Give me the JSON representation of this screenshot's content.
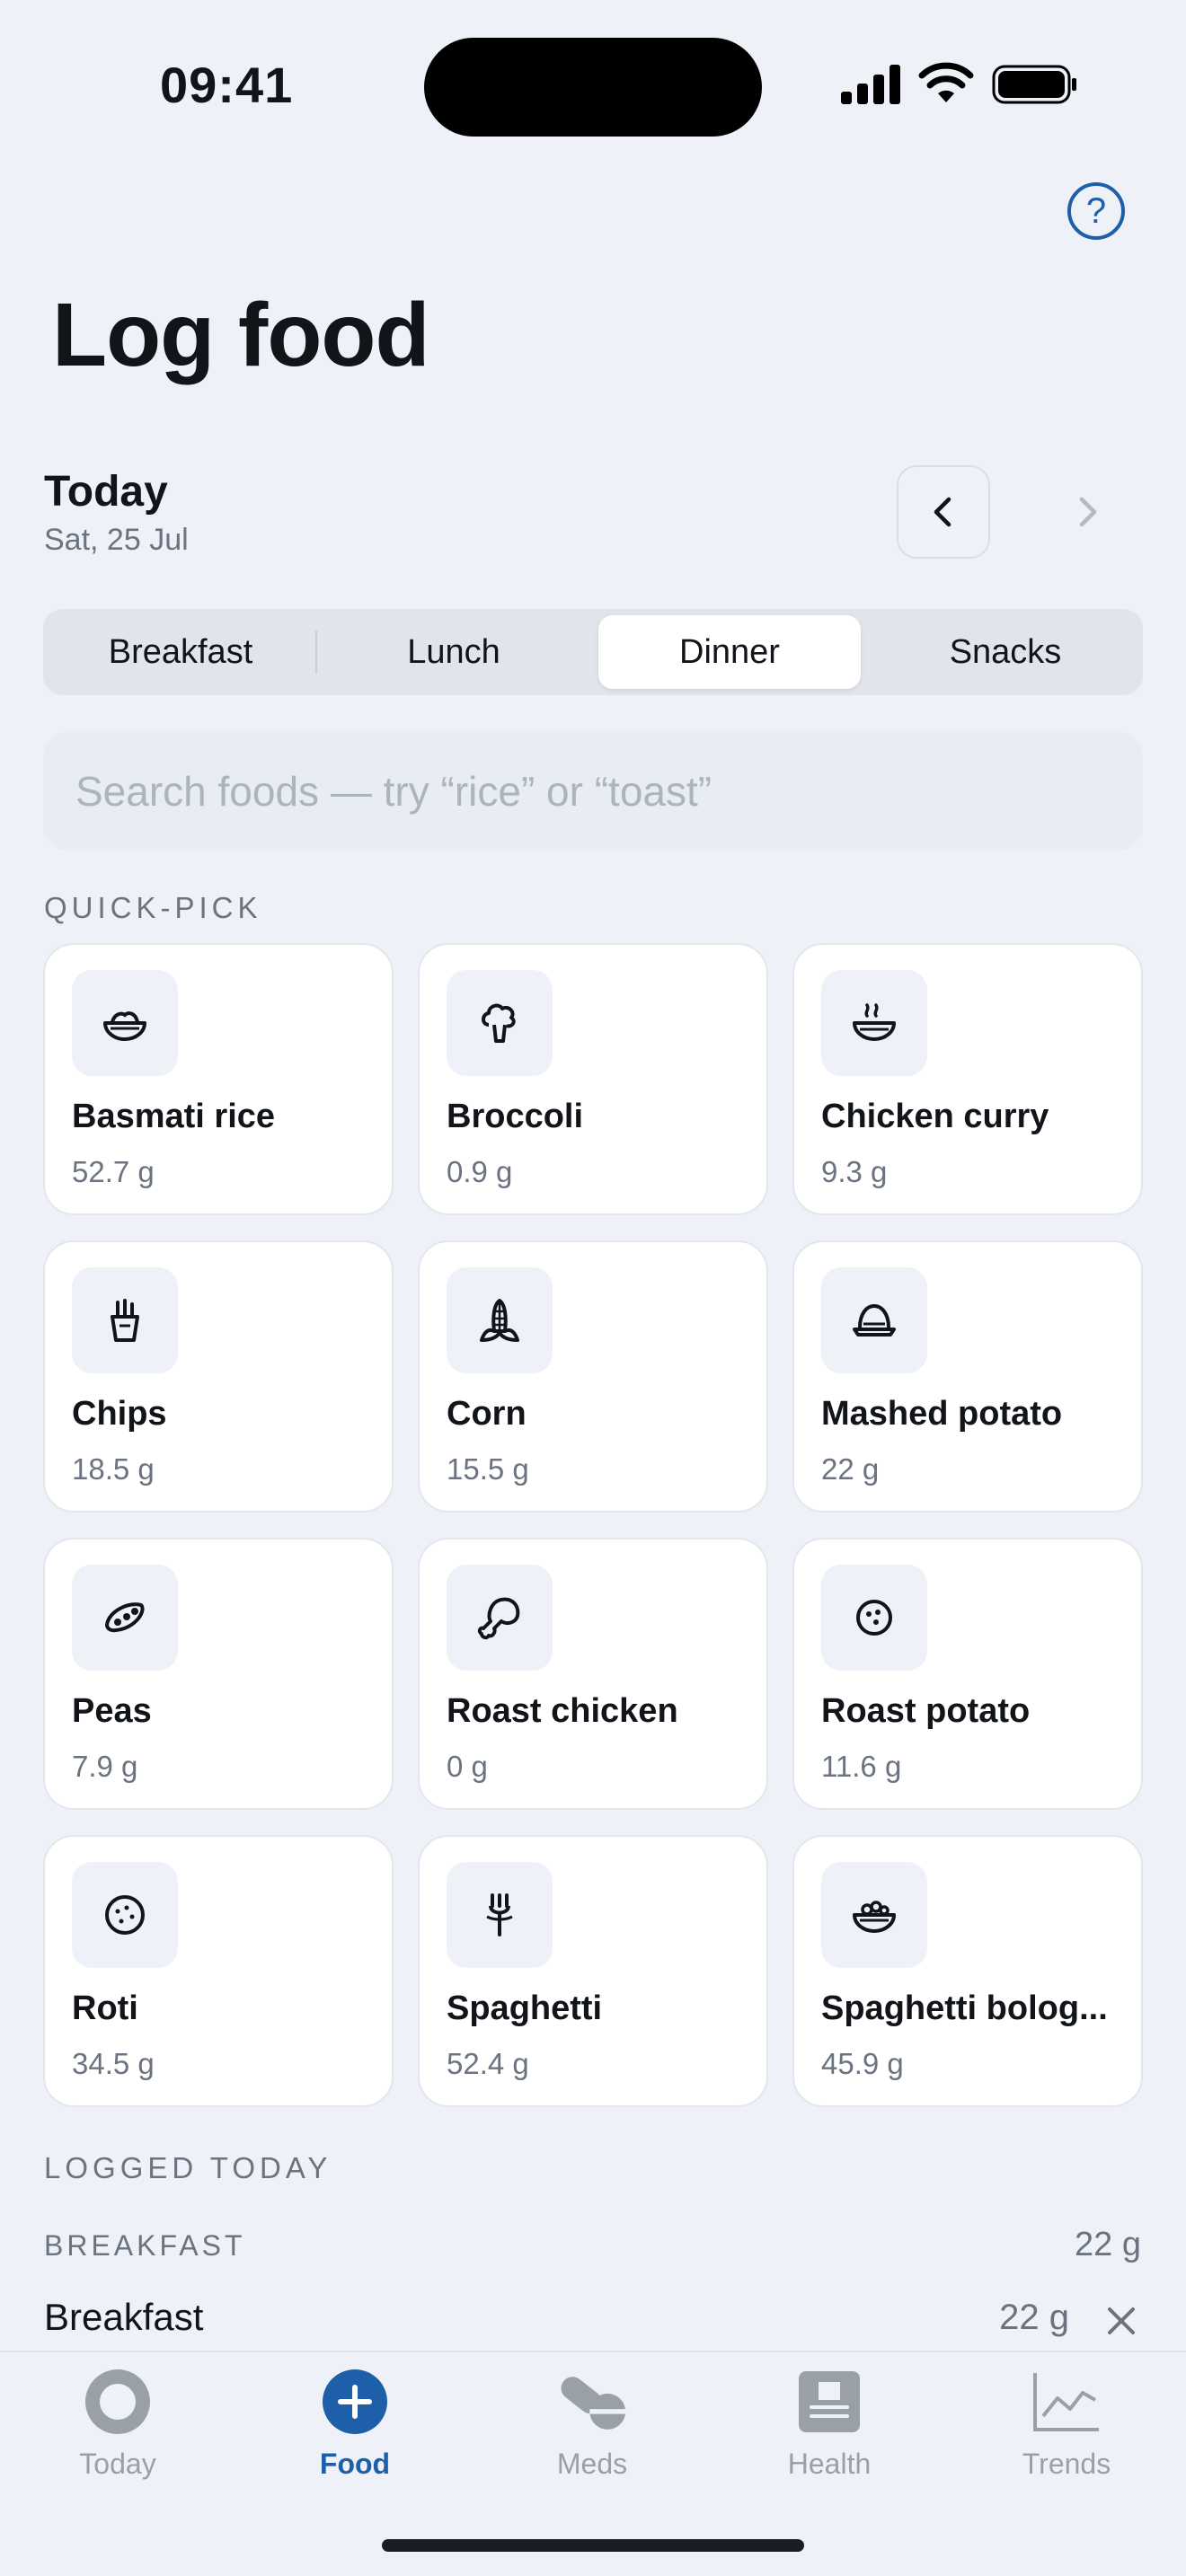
{
  "status_bar": {
    "time": "09:41"
  },
  "header": {
    "title": "Log food",
    "help_icon": "question-circle-icon",
    "help_label": "?"
  },
  "date": {
    "label": "Today",
    "sub": "Sat, 25 Jul"
  },
  "meal_tabs": {
    "items": [
      "Breakfast",
      "Lunch",
      "Dinner",
      "Snacks"
    ],
    "selected": "Dinner"
  },
  "search": {
    "placeholder": "Search foods — try “rice” or “toast”",
    "value": ""
  },
  "quick_pick": {
    "label": "QUICK-PICK",
    "items": [
      {
        "name": "Basmati rice",
        "amount": "52.7 g",
        "icon": "rice-bowl-icon"
      },
      {
        "name": "Broccoli",
        "amount": "0.9 g",
        "icon": "broccoli-icon"
      },
      {
        "name": "Chicken curry",
        "amount": "9.3 g",
        "icon": "curry-bowl-icon"
      },
      {
        "name": "Chips",
        "amount": "18.5 g",
        "icon": "fries-icon"
      },
      {
        "name": "Corn",
        "amount": "15.5 g",
        "icon": "corn-icon"
      },
      {
        "name": "Mashed potato",
        "amount": "22 g",
        "icon": "mash-icon"
      },
      {
        "name": "Peas",
        "amount": "7.9 g",
        "icon": "peas-icon"
      },
      {
        "name": "Roast chicken",
        "amount": "0 g",
        "icon": "drumstick-icon"
      },
      {
        "name": "Roast potato",
        "amount": "11.6 g",
        "icon": "potato-icon"
      },
      {
        "name": "Roti",
        "amount": "34.5 g",
        "icon": "flatbread-icon"
      },
      {
        "name": "Spaghetti",
        "amount": "52.4 g",
        "icon": "fork-icon"
      },
      {
        "name": "Spaghetti bolog...",
        "amount": "45.9 g",
        "icon": "pasta-bowl-icon"
      }
    ]
  },
  "logged_today": {
    "label": "LOGGED TODAY",
    "group_label": "BREAKFAST",
    "group_total": "22 g",
    "rows": [
      {
        "name": "Breakfast",
        "amount": "22 g"
      }
    ]
  },
  "tab_bar": {
    "items": [
      {
        "label": "Today",
        "icon": "ring-icon"
      },
      {
        "label": "Food",
        "icon": "plus-circle-icon"
      },
      {
        "label": "Meds",
        "icon": "pill-icon"
      },
      {
        "label": "Health",
        "icon": "health-card-icon"
      },
      {
        "label": "Trends",
        "icon": "line-chart-icon"
      }
    ],
    "active": "Food"
  },
  "colors": {
    "accent": "#1d5fa8",
    "background": "#eef2f8",
    "muted": "#6b7380"
  }
}
